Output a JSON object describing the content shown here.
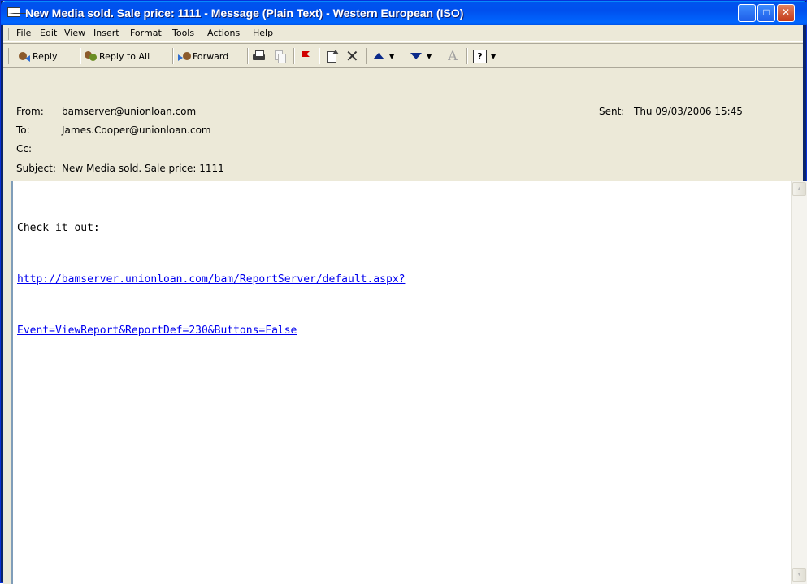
{
  "window": {
    "title": "New Media sold. Sale price: 1111 - Message (Plain Text)  - Western European (ISO)",
    "minimize_glyph": "_",
    "maximize_glyph": "□",
    "close_glyph": "✕"
  },
  "menu": [
    "File",
    "Edit",
    "View",
    "Insert",
    "Format",
    "Tools",
    "Actions",
    "Help"
  ],
  "toolbar": {
    "reply": "Reply",
    "reply_all": "Reply to All",
    "forward": "Forward",
    "delete_glyph": "✕",
    "font_glyph": "A",
    "help_glyph": "?"
  },
  "header": {
    "from_label": "From:",
    "from_value": "bamserver@unionloan.com",
    "to_label": "To:",
    "to_value": "James.Cooper@unionloan.com",
    "cc_label": "Cc:",
    "cc_value": "",
    "subject_label": "Subject:",
    "subject_value": "New Media sold. Sale price: 1111",
    "sent_label": "Sent:",
    "sent_value": "Thu 09/03/2006 15:45"
  },
  "body": {
    "line1": "Check it out:",
    "link_line1": "http://bamserver.unionloan.com/bam/ReportServer/default.aspx?",
    "link_line2": "Event=ViewReport&ReportDef=230&Buttons=False"
  },
  "scroll": {
    "up": "▲",
    "down": "▼"
  },
  "colors": {
    "titlebar": "#0054e3",
    "link": "#0000ee",
    "chrome": "#ece9d8"
  }
}
